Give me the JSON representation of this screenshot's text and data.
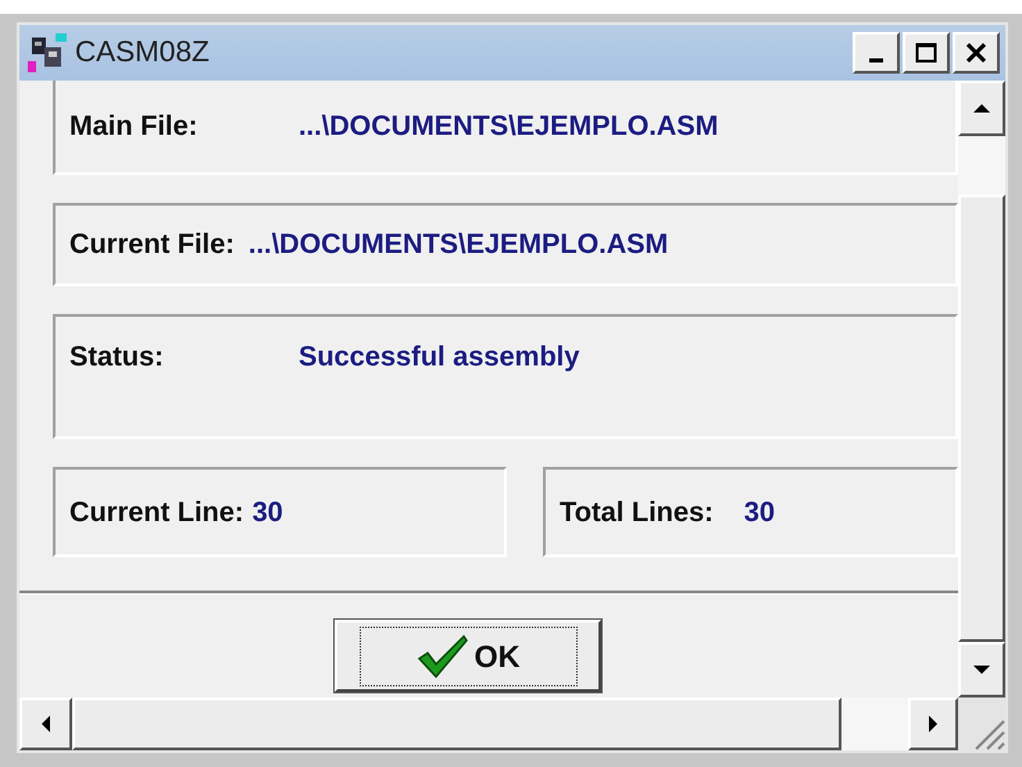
{
  "window": {
    "title": "CASM08Z"
  },
  "fields": [
    {
      "label": "Main File:",
      "value": "...\\DOCUMENTS\\EJEMPLO.ASM"
    },
    {
      "label": "Current File:",
      "value": "...\\DOCUMENTS\\EJEMPLO.ASM"
    },
    {
      "label": "Status:",
      "value": "Successful assembly"
    }
  ],
  "counters": [
    {
      "label": "Current Line:",
      "value": "30"
    },
    {
      "label": "Total Lines:",
      "value": "30"
    }
  ],
  "buttons": [
    {
      "label": "OK"
    }
  ]
}
